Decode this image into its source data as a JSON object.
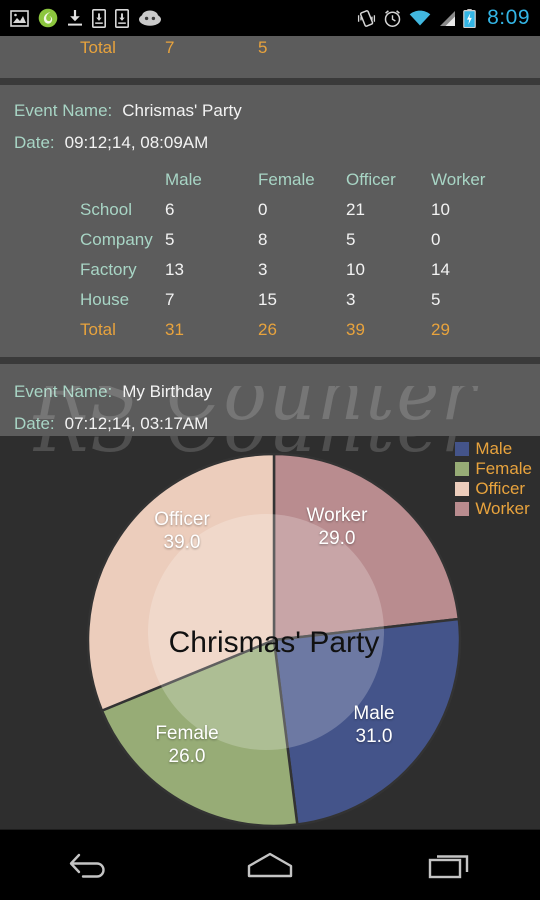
{
  "status_bar": {
    "time": "8:09",
    "left_icons": [
      "gallery-image-icon",
      "green-leaf-app-icon",
      "download-icon",
      "device-download-icon",
      "device-download-alt-icon",
      "cyanogenmod-android-icon"
    ],
    "right_icons": [
      "vibrate-icon",
      "alarm-clock-icon",
      "wifi-icon",
      "cell-signal-icon",
      "battery-charging-icon"
    ],
    "clock_color": "#33b5e5"
  },
  "clipped_top_row": {
    "label": "Total",
    "values": [
      "7",
      "5",
      "",
      ""
    ]
  },
  "events": [
    {
      "name_label": "Event Name:",
      "name": "Chrismas' Party",
      "date_label": "Date:",
      "date": "09:12;14, 08:09AM",
      "columns": [
        "Male",
        "Female",
        "Officer",
        "Worker"
      ],
      "rows": [
        {
          "name": "School",
          "values": [
            "6",
            "0",
            "21",
            "10"
          ]
        },
        {
          "name": "Company",
          "values": [
            "5",
            "8",
            "5",
            "0"
          ]
        },
        {
          "name": "Factory",
          "values": [
            "13",
            "3",
            "10",
            "14"
          ]
        },
        {
          "name": "House",
          "values": [
            "7",
            "15",
            "3",
            "5"
          ]
        }
      ],
      "total": {
        "name": "Total",
        "values": [
          "31",
          "26",
          "39",
          "29"
        ]
      }
    },
    {
      "name_label": "Event Name:",
      "name": "My Birthday",
      "date_label": "Date:",
      "date": "07:12;14, 03:17AM"
    }
  ],
  "watermark": "RS Counter",
  "chart_data": {
    "type": "pie",
    "title": "Chrismas' Party",
    "categories": [
      "Worker",
      "Male",
      "Female",
      "Officer"
    ],
    "values": [
      29.0,
      31.0,
      26.0,
      39.0
    ],
    "value_labels": [
      "29.0",
      "31.0",
      "26.0",
      "39.0"
    ],
    "total": 125.0,
    "start_angle_deg": 0,
    "direction": "clockwise",
    "legend_position": "top-right",
    "legend": [
      {
        "label": "Male",
        "color": "#44548a"
      },
      {
        "label": "Female",
        "color": "#97ac76"
      },
      {
        "label": "Officer",
        "color": "#eccdbc"
      },
      {
        "label": "Worker",
        "color": "#b98c8f"
      }
    ],
    "colors": {
      "Male": "#44548a",
      "Female": "#97ac76",
      "Officer": "#eccdbc",
      "Worker": "#b98c8f"
    },
    "background": "#2e2e2e",
    "label_color": "#ffffff",
    "title_color": "#111111",
    "grid": false
  },
  "theme": {
    "panel_bg": "#5c5c5c",
    "divider": "#3a3a3a",
    "label_color": "#a8d5c5",
    "value_color": "#f3f3f3",
    "total_color": "#e8a33d"
  },
  "nav_bar": {
    "buttons": [
      {
        "name": "back-button",
        "icon": "back-arrow-icon"
      },
      {
        "name": "home-button",
        "icon": "home-icon"
      },
      {
        "name": "recents-button",
        "icon": "recents-icon"
      }
    ]
  }
}
